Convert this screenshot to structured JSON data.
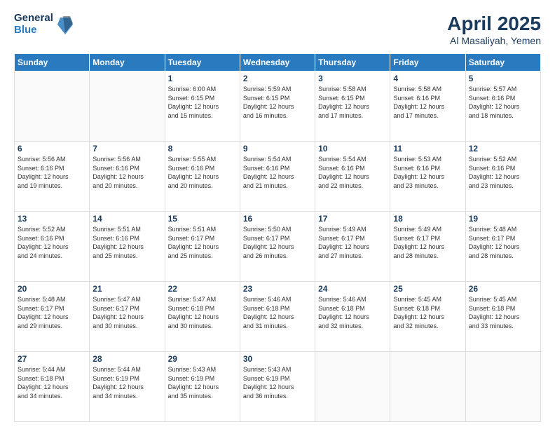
{
  "logo": {
    "general": "General",
    "blue": "Blue"
  },
  "title": {
    "month_year": "April 2025",
    "location": "Al Masaliyah, Yemen"
  },
  "weekdays": [
    "Sunday",
    "Monday",
    "Tuesday",
    "Wednesday",
    "Thursday",
    "Friday",
    "Saturday"
  ],
  "weeks": [
    [
      {
        "day": "",
        "info": ""
      },
      {
        "day": "",
        "info": ""
      },
      {
        "day": "1",
        "info": "Sunrise: 6:00 AM\nSunset: 6:15 PM\nDaylight: 12 hours\nand 15 minutes."
      },
      {
        "day": "2",
        "info": "Sunrise: 5:59 AM\nSunset: 6:15 PM\nDaylight: 12 hours\nand 16 minutes."
      },
      {
        "day": "3",
        "info": "Sunrise: 5:58 AM\nSunset: 6:15 PM\nDaylight: 12 hours\nand 17 minutes."
      },
      {
        "day": "4",
        "info": "Sunrise: 5:58 AM\nSunset: 6:16 PM\nDaylight: 12 hours\nand 17 minutes."
      },
      {
        "day": "5",
        "info": "Sunrise: 5:57 AM\nSunset: 6:16 PM\nDaylight: 12 hours\nand 18 minutes."
      }
    ],
    [
      {
        "day": "6",
        "info": "Sunrise: 5:56 AM\nSunset: 6:16 PM\nDaylight: 12 hours\nand 19 minutes."
      },
      {
        "day": "7",
        "info": "Sunrise: 5:56 AM\nSunset: 6:16 PM\nDaylight: 12 hours\nand 20 minutes."
      },
      {
        "day": "8",
        "info": "Sunrise: 5:55 AM\nSunset: 6:16 PM\nDaylight: 12 hours\nand 20 minutes."
      },
      {
        "day": "9",
        "info": "Sunrise: 5:54 AM\nSunset: 6:16 PM\nDaylight: 12 hours\nand 21 minutes."
      },
      {
        "day": "10",
        "info": "Sunrise: 5:54 AM\nSunset: 6:16 PM\nDaylight: 12 hours\nand 22 minutes."
      },
      {
        "day": "11",
        "info": "Sunrise: 5:53 AM\nSunset: 6:16 PM\nDaylight: 12 hours\nand 23 minutes."
      },
      {
        "day": "12",
        "info": "Sunrise: 5:52 AM\nSunset: 6:16 PM\nDaylight: 12 hours\nand 23 minutes."
      }
    ],
    [
      {
        "day": "13",
        "info": "Sunrise: 5:52 AM\nSunset: 6:16 PM\nDaylight: 12 hours\nand 24 minutes."
      },
      {
        "day": "14",
        "info": "Sunrise: 5:51 AM\nSunset: 6:16 PM\nDaylight: 12 hours\nand 25 minutes."
      },
      {
        "day": "15",
        "info": "Sunrise: 5:51 AM\nSunset: 6:17 PM\nDaylight: 12 hours\nand 25 minutes."
      },
      {
        "day": "16",
        "info": "Sunrise: 5:50 AM\nSunset: 6:17 PM\nDaylight: 12 hours\nand 26 minutes."
      },
      {
        "day": "17",
        "info": "Sunrise: 5:49 AM\nSunset: 6:17 PM\nDaylight: 12 hours\nand 27 minutes."
      },
      {
        "day": "18",
        "info": "Sunrise: 5:49 AM\nSunset: 6:17 PM\nDaylight: 12 hours\nand 28 minutes."
      },
      {
        "day": "19",
        "info": "Sunrise: 5:48 AM\nSunset: 6:17 PM\nDaylight: 12 hours\nand 28 minutes."
      }
    ],
    [
      {
        "day": "20",
        "info": "Sunrise: 5:48 AM\nSunset: 6:17 PM\nDaylight: 12 hours\nand 29 minutes."
      },
      {
        "day": "21",
        "info": "Sunrise: 5:47 AM\nSunset: 6:17 PM\nDaylight: 12 hours\nand 30 minutes."
      },
      {
        "day": "22",
        "info": "Sunrise: 5:47 AM\nSunset: 6:18 PM\nDaylight: 12 hours\nand 30 minutes."
      },
      {
        "day": "23",
        "info": "Sunrise: 5:46 AM\nSunset: 6:18 PM\nDaylight: 12 hours\nand 31 minutes."
      },
      {
        "day": "24",
        "info": "Sunrise: 5:46 AM\nSunset: 6:18 PM\nDaylight: 12 hours\nand 32 minutes."
      },
      {
        "day": "25",
        "info": "Sunrise: 5:45 AM\nSunset: 6:18 PM\nDaylight: 12 hours\nand 32 minutes."
      },
      {
        "day": "26",
        "info": "Sunrise: 5:45 AM\nSunset: 6:18 PM\nDaylight: 12 hours\nand 33 minutes."
      }
    ],
    [
      {
        "day": "27",
        "info": "Sunrise: 5:44 AM\nSunset: 6:18 PM\nDaylight: 12 hours\nand 34 minutes."
      },
      {
        "day": "28",
        "info": "Sunrise: 5:44 AM\nSunset: 6:19 PM\nDaylight: 12 hours\nand 34 minutes."
      },
      {
        "day": "29",
        "info": "Sunrise: 5:43 AM\nSunset: 6:19 PM\nDaylight: 12 hours\nand 35 minutes."
      },
      {
        "day": "30",
        "info": "Sunrise: 5:43 AM\nSunset: 6:19 PM\nDaylight: 12 hours\nand 36 minutes."
      },
      {
        "day": "",
        "info": ""
      },
      {
        "day": "",
        "info": ""
      },
      {
        "day": "",
        "info": ""
      }
    ]
  ]
}
